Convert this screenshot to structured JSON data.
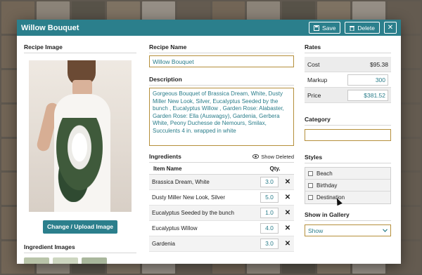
{
  "modal": {
    "title": "Willow Bouquet",
    "save_label": "Save",
    "delete_label": "Delete",
    "close_glyph": "✕"
  },
  "left": {
    "recipe_image_label": "Recipe Image",
    "upload_button": "Change / Upload Image",
    "ingredient_images_label": "Ingredient Images"
  },
  "recipe": {
    "name_label": "Recipe Name",
    "name_value": "Willow Bouquet",
    "description_label": "Description",
    "description_value": "Gorgeous Bouquet of Brassica Dream, White, Dusty Miller New Look, Silver, Eucalyptus Seeded by the bunch , Eucalyptus Willow , Garden Rose: Alabaster, Garden Rose: Ella (Auswagsy), Gardenia, Gerbera White, Peony Duchesse de Nemours, Smilax, Succulents 4 in. wrapped in white"
  },
  "ingredients": {
    "label": "Ingredients",
    "show_deleted": "Show Deleted",
    "col_item": "Item Name",
    "col_qty": "Qty.",
    "rows": [
      {
        "name": "Brassica Dream, White",
        "qty": "3.0"
      },
      {
        "name": "Dusty Miller New Look, Silver",
        "qty": "5.0"
      },
      {
        "name": "Eucalyptus Seeded by the bunch",
        "qty": "1.0"
      },
      {
        "name": "Eucalyptus Willow",
        "qty": "4.0"
      },
      {
        "name": "Gardenia",
        "qty": "3.0"
      }
    ]
  },
  "rates": {
    "label": "Rates",
    "cost_label": "Cost",
    "cost_value": "$95.38",
    "markup_label": "Markup",
    "markup_value": "300",
    "price_label": "Price",
    "price_value": "$381.52"
  },
  "category": {
    "label": "Category",
    "value": ""
  },
  "styles": {
    "label": "Styles",
    "items": [
      "Beach",
      "Birthday",
      "Destination"
    ]
  },
  "gallery": {
    "label": "Show in Gallery",
    "value": "Show"
  },
  "colors": {
    "header": "#2b7f8c",
    "accent_text": "#2a7d8a",
    "input_border": "#b58f3b"
  }
}
